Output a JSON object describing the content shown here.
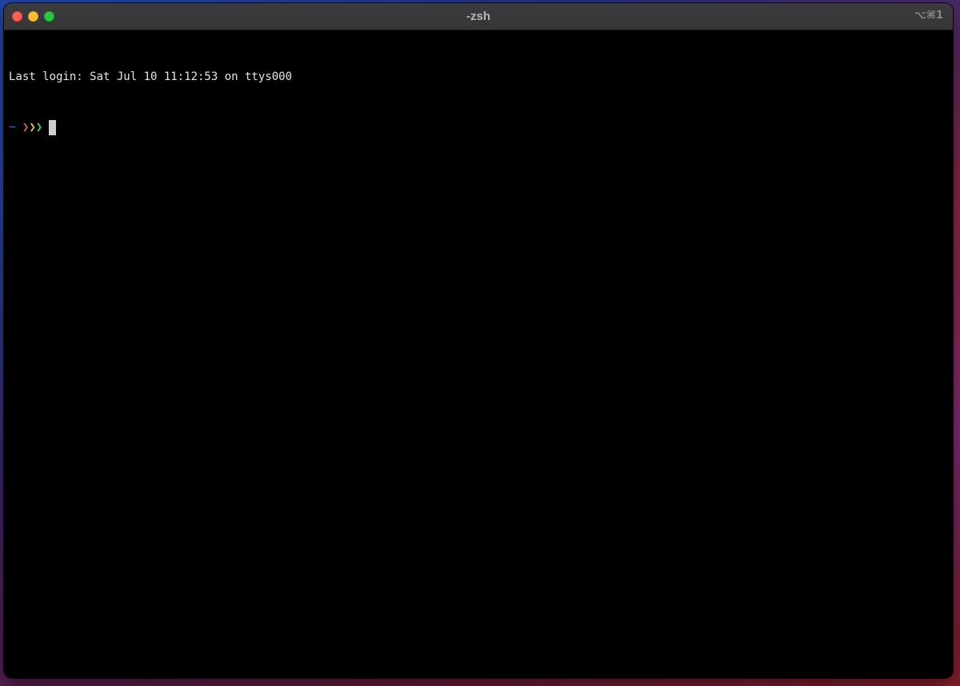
{
  "window": {
    "title": "-zsh",
    "shortcut": "⌥⌘1"
  },
  "terminal": {
    "last_login": "Last login: Sat Jul 10 11:12:53 on ttys000",
    "prompt": {
      "dir": "~",
      "chevron_1": "❯",
      "chevron_2": "❯",
      "chevron_3": "❯"
    }
  },
  "colors": {
    "terminal_background": "#000000",
    "text": "#e6e6e6",
    "prompt_dir": "#5b6be0",
    "chevron_red": "#e05a5a",
    "chevron_yellow": "#e3c24a",
    "chevron_green": "#55c95f",
    "cursor": "#cfcfcf"
  },
  "icons": {
    "close": "close-button",
    "minimize": "minimize-button",
    "zoom": "zoom-button"
  }
}
